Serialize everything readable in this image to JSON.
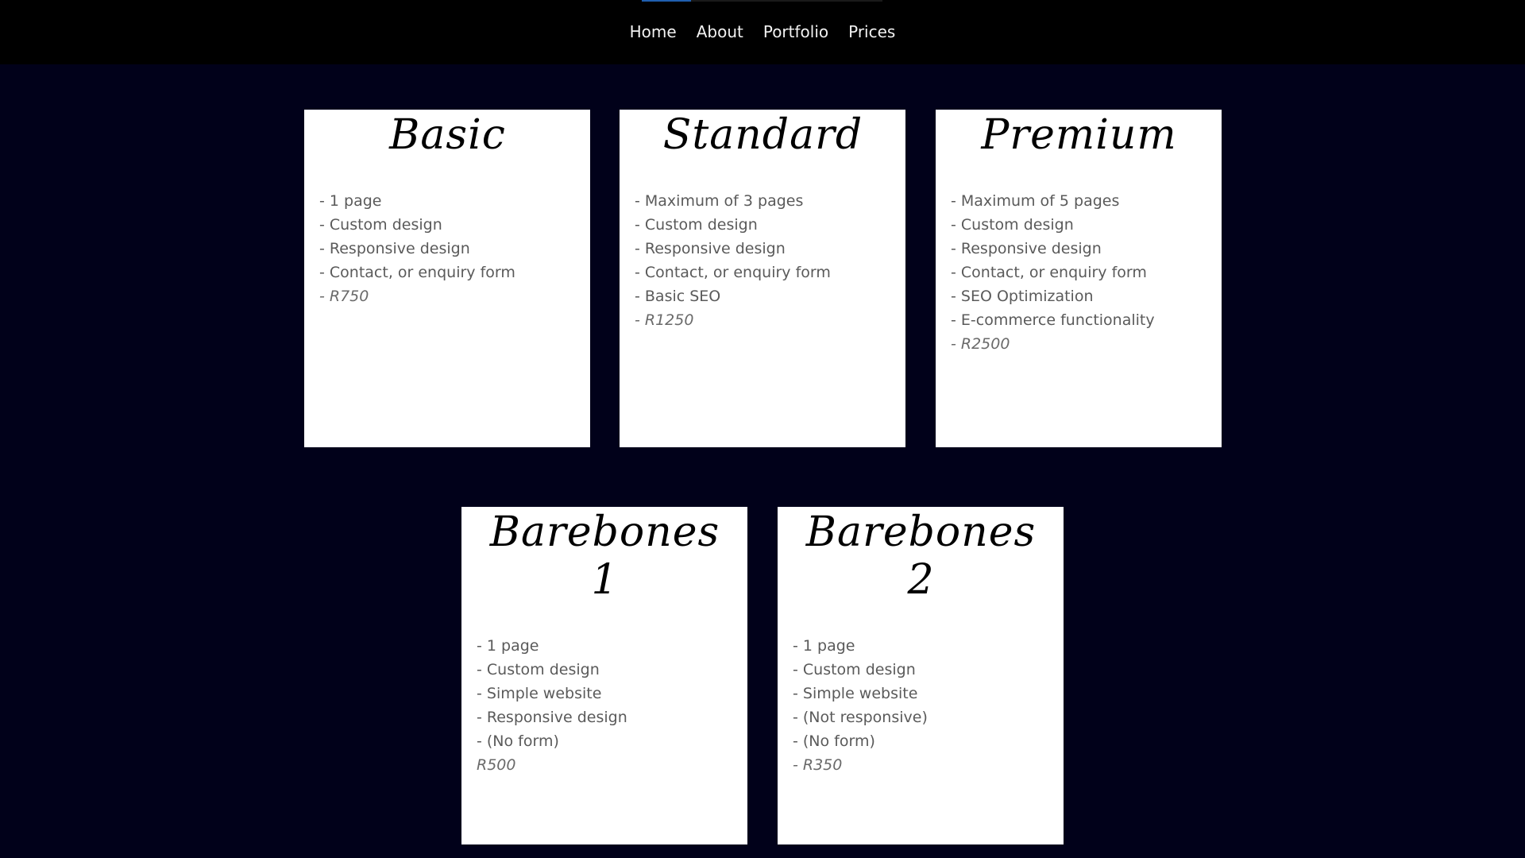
{
  "nav": {
    "links": [
      "Home",
      "About",
      "Portfolio",
      "Prices"
    ]
  },
  "colors": {
    "page_background": "#01011a",
    "nav_background": "#000000",
    "nav_active_indicator": "#1f5fb0",
    "card_background": "#ffffff"
  },
  "plans": [
    {
      "title": "Basic",
      "features": [
        "- 1 page",
        "- Custom design",
        "- Responsive design",
        "- Contact, or enquiry form"
      ],
      "price": "- R750"
    },
    {
      "title": "Standard",
      "features": [
        "- Maximum of 3 pages",
        "- Custom design",
        "- Responsive design",
        "- Contact, or enquiry form",
        "- Basic SEO"
      ],
      "price": "- R1250"
    },
    {
      "title": "Premium",
      "features": [
        "- Maximum of 5 pages",
        "- Custom design",
        "- Responsive design",
        "- Contact, or enquiry form",
        "- SEO Optimization",
        "- E-commerce functionality"
      ],
      "price": "- R2500"
    },
    {
      "title": "Barebones 1",
      "features": [
        "- 1 page",
        "- Custom design",
        "- Simple website",
        "- Responsive design",
        "- (No form)"
      ],
      "price": "R500"
    },
    {
      "title": "Barebones 2",
      "features": [
        "- 1 page",
        "- Custom design",
        "- Simple website",
        "- (Not responsive)",
        "- (No form)"
      ],
      "price": "- R350"
    }
  ]
}
